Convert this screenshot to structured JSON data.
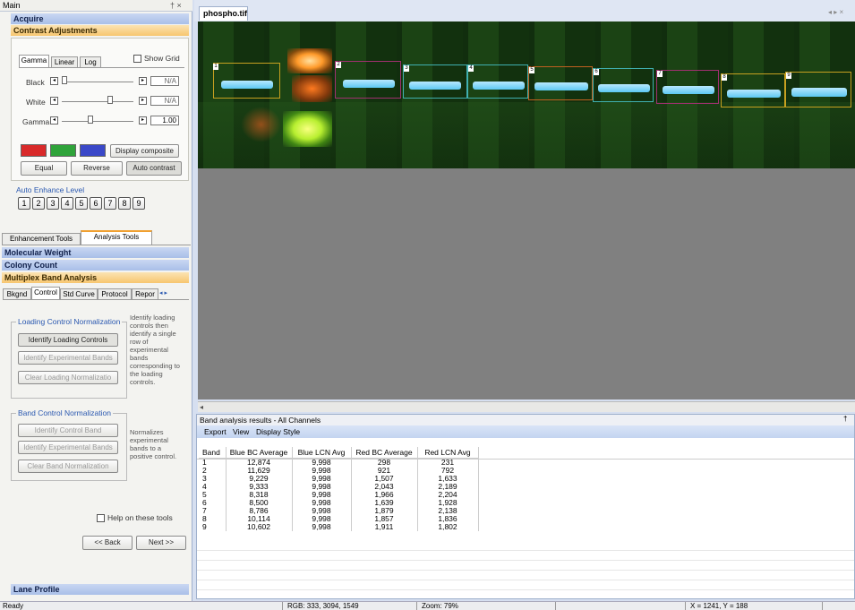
{
  "panel": {
    "title": "Main",
    "pin_close": "† ×",
    "acquire": "Acquire",
    "contrast": "Contrast Adjustments",
    "mode_tabs": [
      "Gamma",
      "Linear",
      "Log"
    ],
    "show_grid": "Show Grid",
    "black_label": "Black",
    "white_label": "White",
    "gamma_label": "Gamma",
    "black_value": "N/A",
    "white_value": "N/A",
    "gamma_value": "1.00",
    "display_composite": "Display composite",
    "equal": "Equal",
    "reverse": "Reverse",
    "auto_contrast": "Auto contrast",
    "auto_enhance": "Auto Enhance Level",
    "levels": [
      "1",
      "2",
      "3",
      "4",
      "5",
      "6",
      "7",
      "8",
      "9"
    ],
    "tool_tabs": [
      "Enhancement Tools",
      "Analysis Tools"
    ],
    "molecular_weight": "Molecular Weight",
    "colony_count": "Colony Count",
    "multiplex": "Multiplex Band Analysis",
    "sub_tabs": [
      "Bkgnd",
      "Control",
      "Std Curve",
      "Protocol",
      "Repor"
    ],
    "loading_group": "Loading Control Normalization",
    "identify_loading": "Identify Loading Controls",
    "identify_experimental": "Identify Experimental Bands",
    "clear_loading": "Clear Loading Normalizatio",
    "loading_help": "Identify loading controls then identify a single row of experimental bands corresponding to the loading controls.",
    "band_group": "Band Control Normalization",
    "identify_control_band": "Identify Control Band",
    "identify_experimental2": "Identify Experimental Bands",
    "clear_band": "Clear Band Normalization",
    "band_help": "Normalizes experimental bands to a positive control.",
    "help_tools": "Help on these tools",
    "back": "<< Back",
    "next": "Next >>",
    "lane_profile": "Lane Profile"
  },
  "document": {
    "tab": "phospho.tif",
    "nav": "◂ ▸ ×",
    "bands": [
      "1",
      "2",
      "3",
      "4",
      "5",
      "6",
      "7",
      "8",
      "9"
    ]
  },
  "results": {
    "title": "Band analysis results - All Channels",
    "pin": "†",
    "menu": [
      "Export",
      "View",
      "Display Style"
    ],
    "columns": [
      "Band",
      "Blue BC Average",
      "Blue LCN Avg",
      "Red BC Average",
      "Red LCN Avg"
    ],
    "rows": [
      [
        "1",
        "12,874",
        "9,998",
        "298",
        "231"
      ],
      [
        "2",
        "11,629",
        "9,998",
        "921",
        "792"
      ],
      [
        "3",
        "9,229",
        "9,998",
        "1,507",
        "1,633"
      ],
      [
        "4",
        "9,333",
        "9,998",
        "2,043",
        "2,189"
      ],
      [
        "5",
        "8,318",
        "9,998",
        "1,966",
        "2,204"
      ],
      [
        "6",
        "8,500",
        "9,998",
        "1,639",
        "1,928"
      ],
      [
        "7",
        "8,786",
        "9,998",
        "1,879",
        "2,138"
      ],
      [
        "8",
        "10,114",
        "9,998",
        "1,857",
        "1,836"
      ],
      [
        "9",
        "10,602",
        "9,998",
        "1,911",
        "1,802"
      ]
    ]
  },
  "status": {
    "ready": "Ready",
    "rgb": "RGB: 333, 3094, 1549",
    "zoom": "Zoom: 79%",
    "coords": "X = 1241, Y = 188"
  },
  "colors": {
    "header_blue": "#b5c8ec",
    "header_orange": "#f7c66f",
    "swatch_red": "#d92a2a",
    "swatch_green": "#2fa33a",
    "swatch_blue": "#3a48c8"
  }
}
